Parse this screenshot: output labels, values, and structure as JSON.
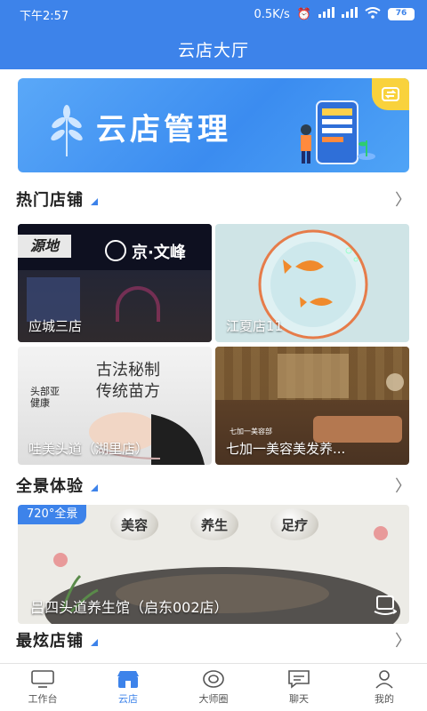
{
  "status": {
    "time": "下午2:57",
    "network_speed": "0.5K/s",
    "battery": "76"
  },
  "header": {
    "title": "云店大厅"
  },
  "banner": {
    "title": "云店管理"
  },
  "sections": {
    "hot": {
      "title": "热门店铺"
    },
    "panorama": {
      "title": "全景体验"
    },
    "coolest": {
      "title": "最炫店铺"
    }
  },
  "hot_stores": [
    {
      "name": "应城三店",
      "sign": "京·文峰"
    },
    {
      "name": "江夏店11"
    },
    {
      "name": "哇美头道（湖里店）",
      "poster_line1": "古法秘制",
      "poster_line2": "传统苗方"
    },
    {
      "name": "七加一美容美发养...",
      "watermark": "七加一美容部"
    }
  ],
  "panorama_store": {
    "badge": "720°全景",
    "name": "吕四头道养生馆（启东002店）",
    "tags": [
      "美容",
      "养生",
      "足疗"
    ]
  },
  "tabs": [
    {
      "label": "工作台",
      "icon": "monitor-icon",
      "active": false
    },
    {
      "label": "云店",
      "icon": "store-icon",
      "active": true
    },
    {
      "label": "大师圈",
      "icon": "circle-icon",
      "active": false
    },
    {
      "label": "聊天",
      "icon": "chat-icon",
      "active": false
    },
    {
      "label": "我的",
      "icon": "person-icon",
      "active": false
    }
  ],
  "colors": {
    "primary": "#3d83ea",
    "badge_yellow": "#f9d23c"
  }
}
